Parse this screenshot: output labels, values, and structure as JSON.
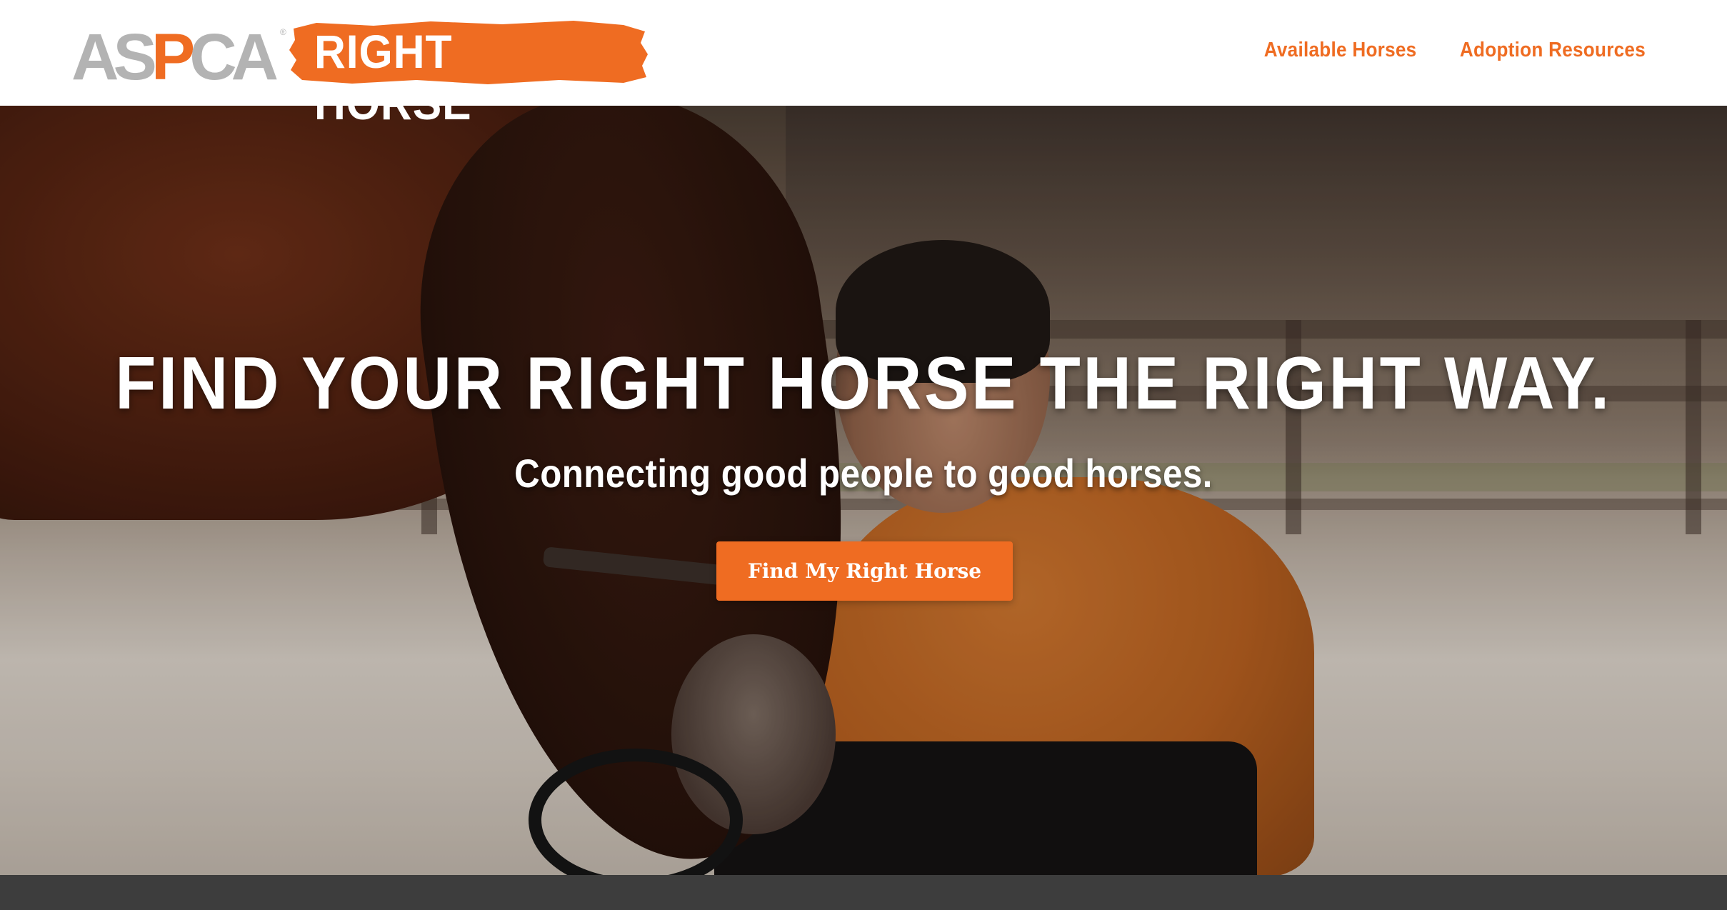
{
  "brand": {
    "aspca_text": "ASPCA",
    "registered_mark": "®",
    "program_name": "RIGHT HORSE",
    "colors": {
      "orange": "#ef6c22",
      "gray": "#b3b3b3"
    }
  },
  "nav": {
    "items": [
      {
        "label": "Available Horses"
      },
      {
        "label": "Adoption Resources"
      }
    ]
  },
  "hero": {
    "title": "FIND YOUR RIGHT HORSE THE RIGHT WAY.",
    "subtitle": "Connecting good people to good horses.",
    "cta_label": "Find My Right Horse"
  }
}
